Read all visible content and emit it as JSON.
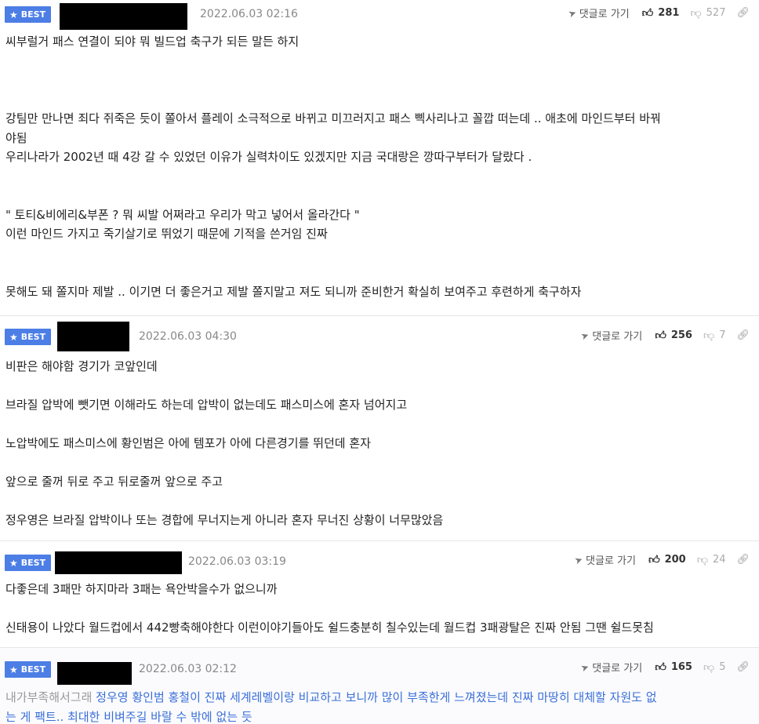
{
  "labels": {
    "badge": "BEST",
    "reply": "댓글로 가기"
  },
  "icons": {
    "badge": "star-icon",
    "reply": "paper-plane-icon",
    "like": "thumbs-up-icon",
    "dislike": "thumbs-down-icon",
    "link": "link-icon"
  },
  "colors": {
    "badge_bg": "#4c7ee5",
    "link_text": "#3a6fd8",
    "muted_text": "#999999",
    "date_text": "#888888"
  },
  "comments": [
    {
      "date": "2022.06.03 02:16",
      "likes": "281",
      "dislikes": "527",
      "lines": [
        "씨부럴거 패스 연결이 되야 뭐 빌드업 축구가 되든 말든 하지",
        "",
        "",
        "",
        "강팀만 만나면 죄다 쥐죽은 듯이 쫄아서 플레이 소극적으로 바뀌고 미끄러지고 패스 삑사리나고 꼴깝 떠는데 .. 애초에 마인드부터 바꿔",
        "야됨",
        "우리나라가 2002년 때 4강 갈 수 있었던 이유가 실력차이도 있겠지만 지금 국대랑은 깡따구부터가 달랐다 .",
        "",
        "",
        "\" 토티&비에리&부폰 ? 뭐 씨발 어쩌라고 우리가 막고 넣어서 올라간다 \"",
        "이런 마인드 가지고 죽기살기로 뛰었기 때문에 기적을 쓴거임 진짜",
        "",
        "",
        "못해도 돼 쫄지마 제발 .. 이기면 더 좋은거고 제발 쫄지말고 져도 되니까 준비한거 확실히 보여주고 후련하게 축구하자"
      ]
    },
    {
      "date": "2022.06.03 04:30",
      "likes": "256",
      "dislikes": "7",
      "lines": [
        "비판은 해야함 경기가 코앞인데",
        "",
        "브라질 압박에 뺏기면 이해라도 하는데 압박이 없는데도 패스미스에 혼자 넘어지고",
        "",
        "노압박에도 패스미스에 황인범은 아에 템포가 아에 다른경기를 뛰던데 혼자",
        "",
        "앞으로 줄꺼 뒤로 주고 뒤로줄꺼 앞으로 주고",
        "",
        "정우영은 브라질 압박이나 또는 경합에 무너지는게 아니라 혼자 무너진 상황이 너무많았음"
      ]
    },
    {
      "date": "2022.06.03 03:19",
      "likes": "200",
      "dislikes": "24",
      "lines": [
        "다좋은데 3패만 하지마라 3패는 욕안박을수가 없으니까",
        "",
        "신태용이 나았다 월드컵에서 442빵축해야한다 이런이야기들아도 쉴드충분히 칠수있는데 월드컵 3패광탈은 진짜 안됨 그땐 쉴드못침"
      ]
    },
    {
      "date": "2022.06.03 02:12",
      "likes": "165",
      "dislikes": "5",
      "muted_prefix": "내가부족해서그래 ",
      "link_line1": "정우영 황인범 홍철이 진짜 세계레벨이랑 비교하고 보니까 많이 부족한게 느껴졌는데 진짜 마땅히 대체할 자원도 없",
      "link_line2": "는 게 팩트.. 최대한 비벼주길 바랄 수 밖에 없는 듯"
    }
  ]
}
